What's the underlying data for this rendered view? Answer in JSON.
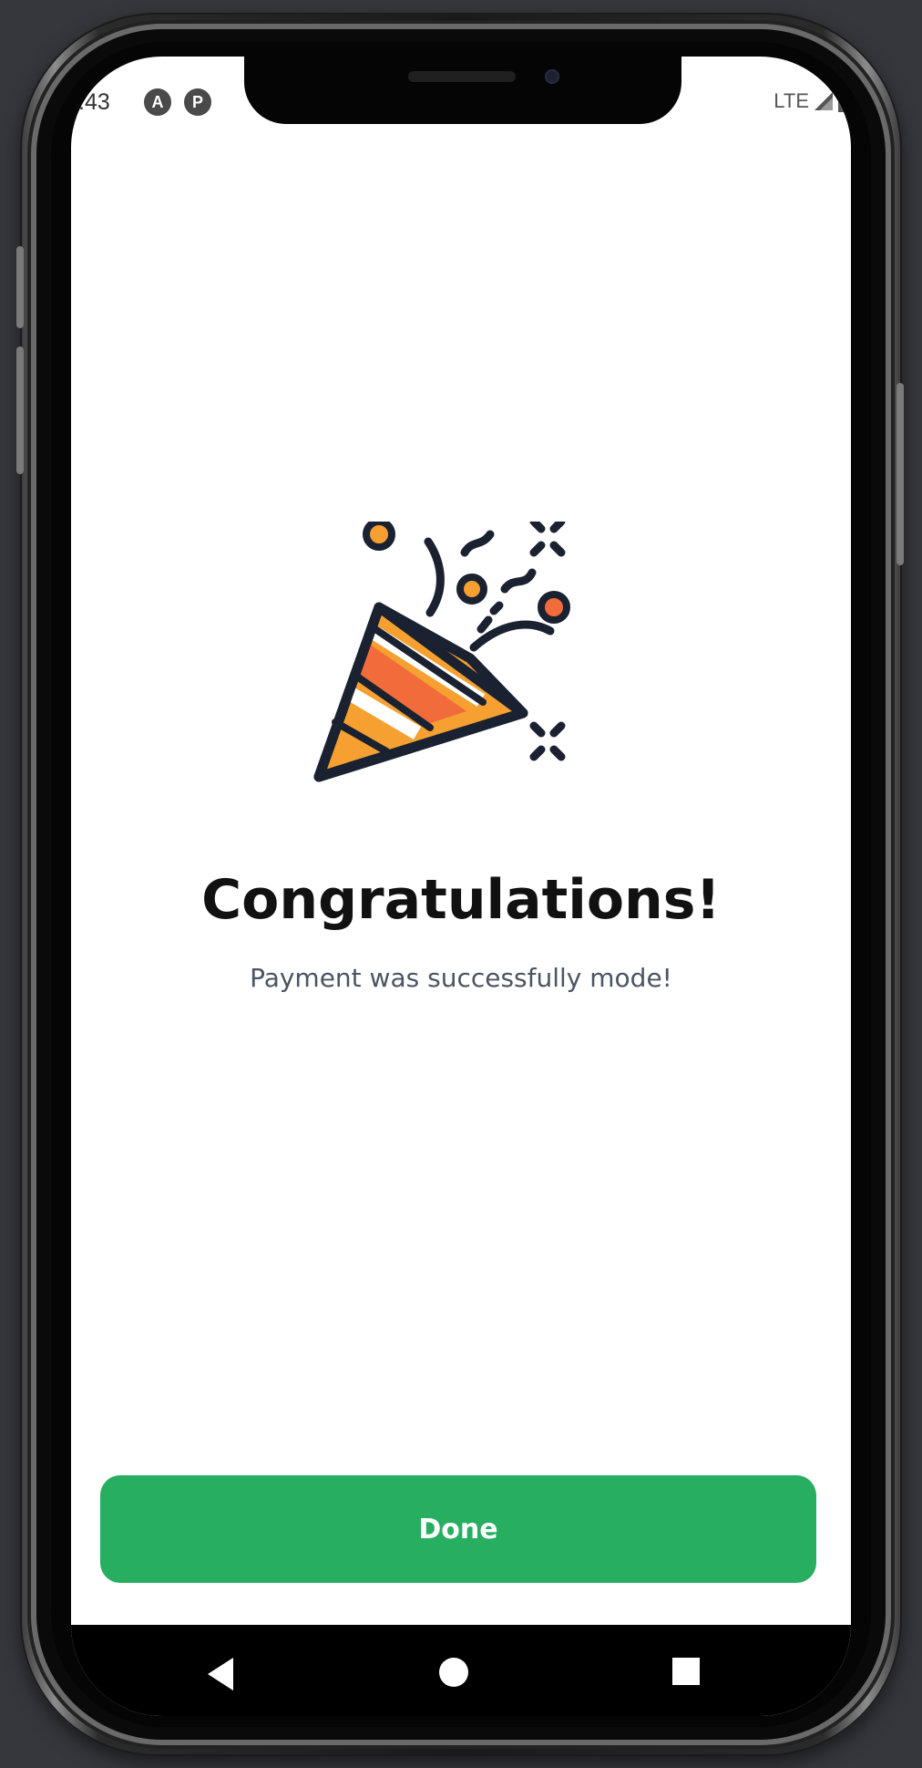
{
  "status_bar": {
    "time": ":43",
    "icon_a": "A",
    "icon_b": "P",
    "network": "LTE"
  },
  "main": {
    "title": "Congratulations!",
    "subtitle": "Payment was successfully mode!",
    "illustration_icon": "party-popper-icon"
  },
  "actions": {
    "done_label": "Done"
  },
  "navbar": {
    "back_icon": "back-triangle-icon",
    "home_icon": "home-circle-icon",
    "recents_icon": "recents-square-icon"
  },
  "colors": {
    "primary_button": "#27ae60",
    "title_text": "#111111",
    "subtitle_text": "#4b5563",
    "popper_orange": "#f5a030",
    "popper_red": "#f26b3a",
    "outline": "#1a2130"
  }
}
